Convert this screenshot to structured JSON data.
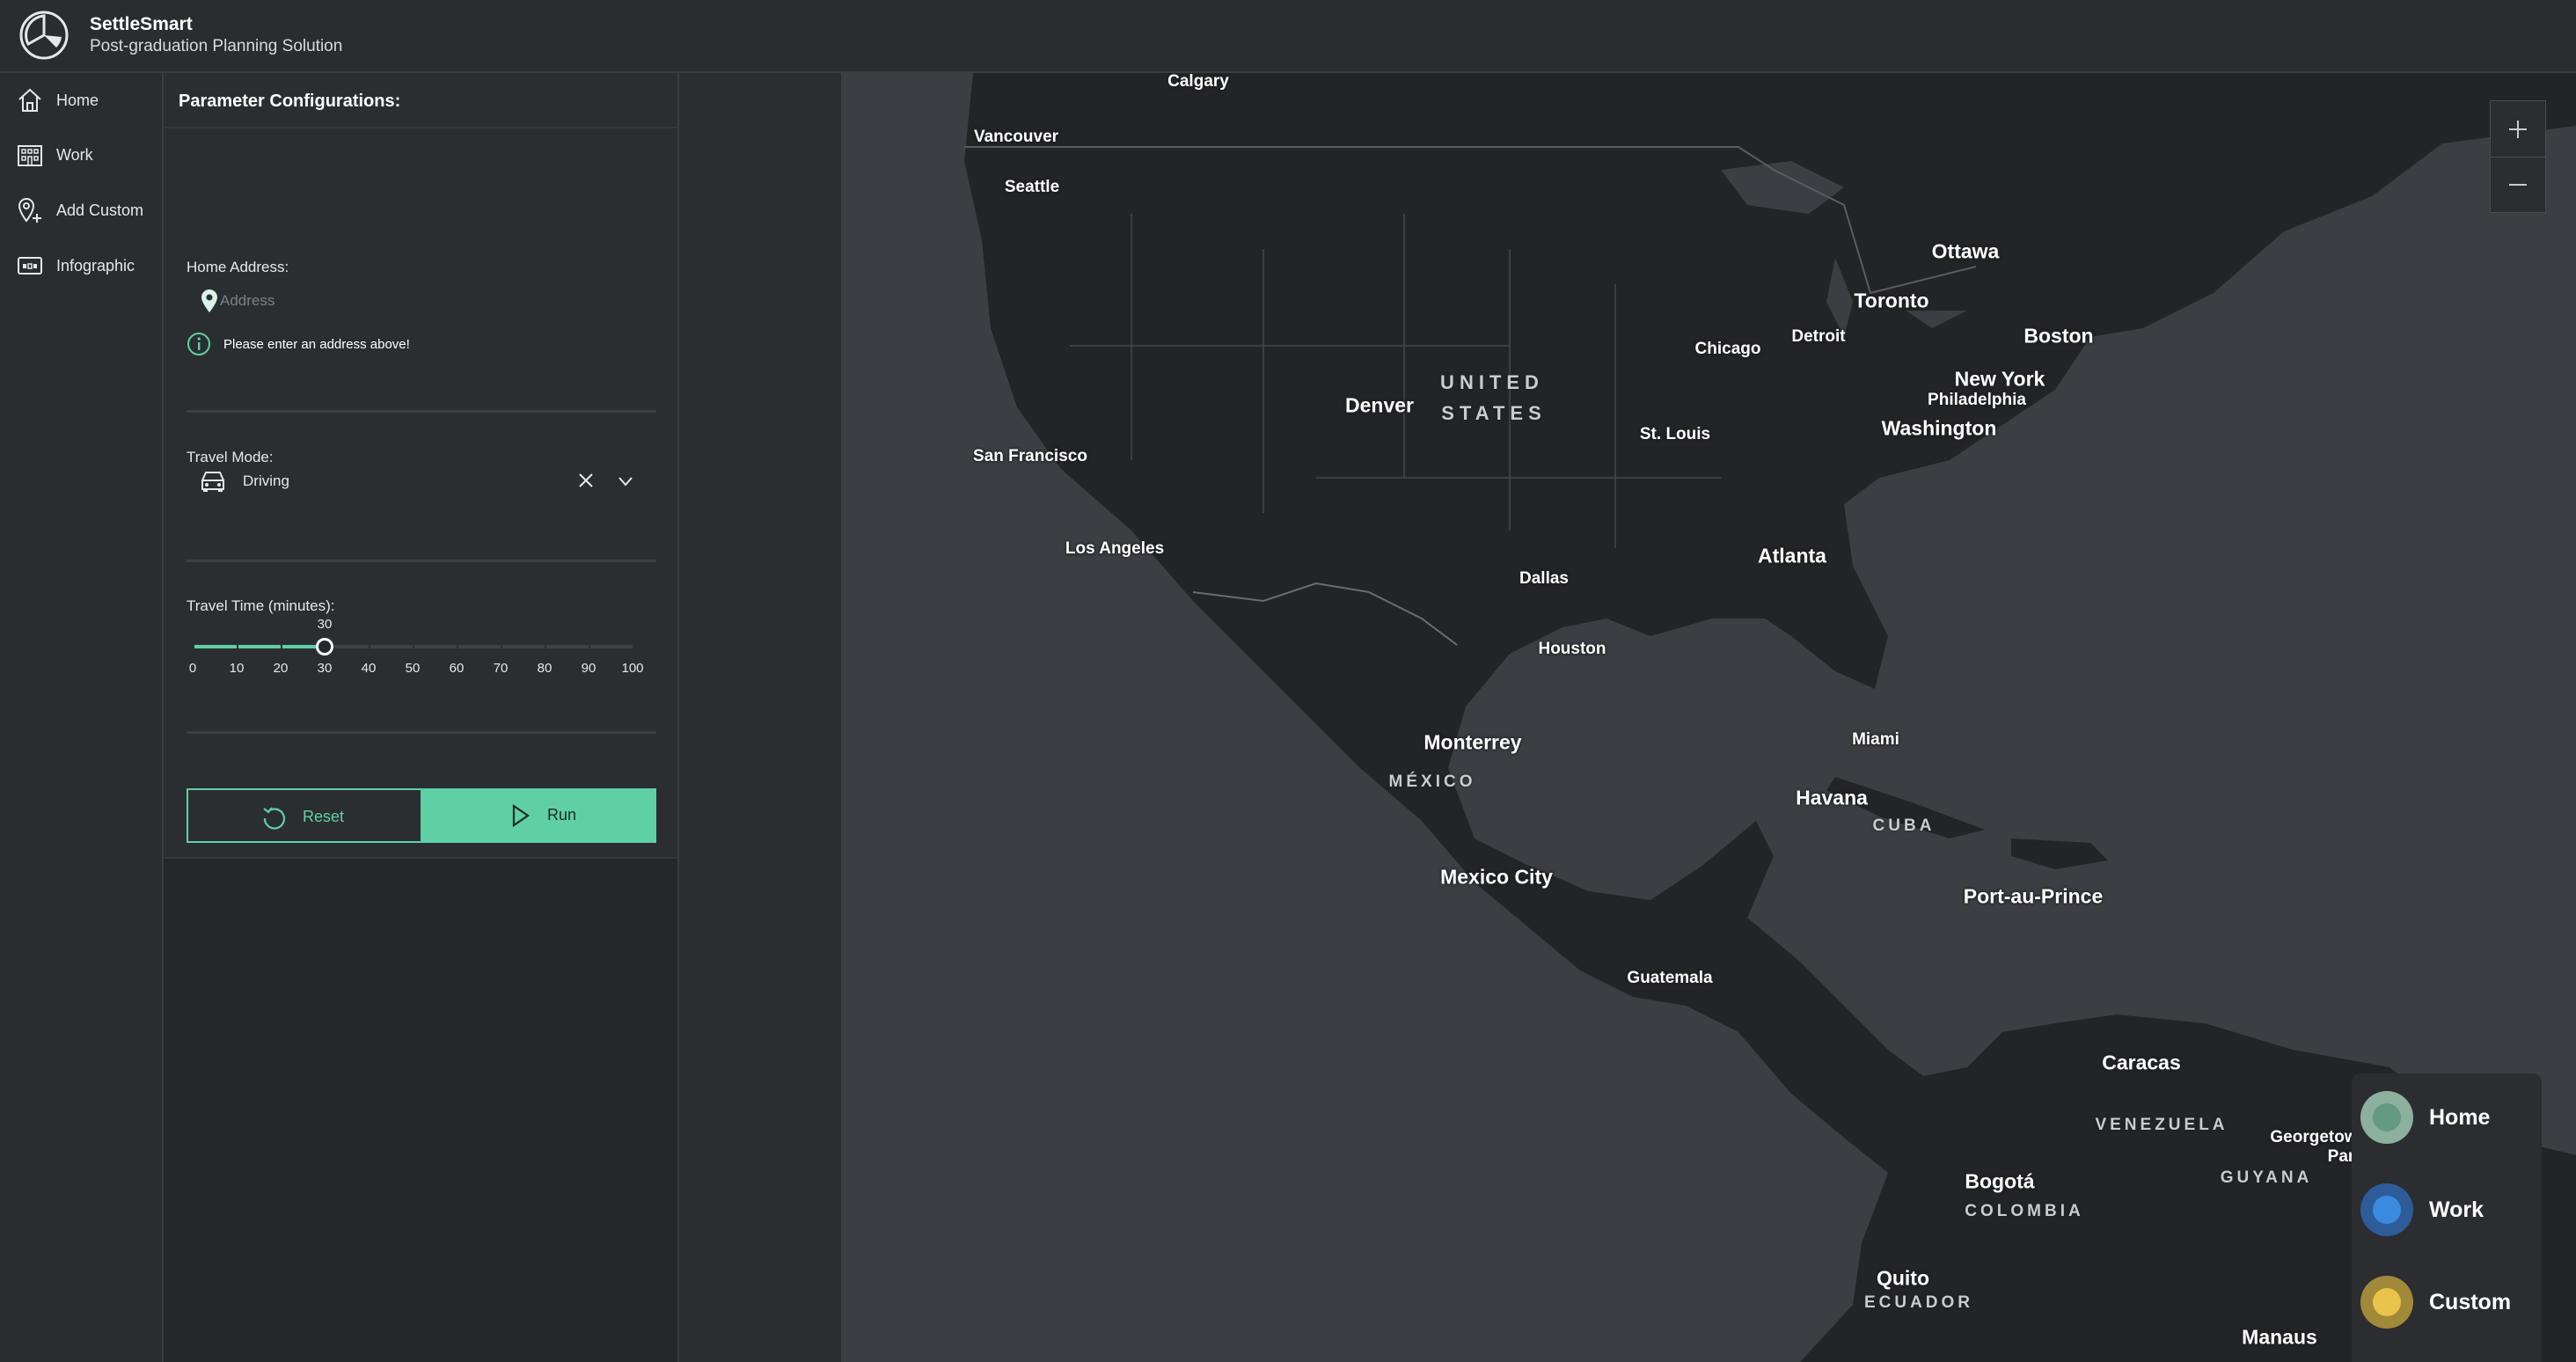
{
  "app": {
    "title": "SettleSmart",
    "subtitle": "Post-graduation Planning Solution"
  },
  "nav": {
    "items": [
      {
        "label": "Home",
        "icon": "home-icon"
      },
      {
        "label": "Work",
        "icon": "building-icon"
      },
      {
        "label": "Add Custom",
        "icon": "add-location-icon"
      },
      {
        "label": "Infographic",
        "icon": "infographic-icon"
      }
    ]
  },
  "panel": {
    "title": "Parameter Configurations:",
    "home_address": {
      "label": "Home Address:",
      "value": "",
      "placeholder": "Address",
      "warning": "Please enter an address above!"
    },
    "travel_mode": {
      "label": "Travel Mode:",
      "value": "Driving"
    },
    "travel_time": {
      "label": "Travel Time (minutes):",
      "value": 30,
      "value_label": "30",
      "min": 0,
      "max": 100,
      "ticks": [
        "0",
        "10",
        "20",
        "30",
        "40",
        "50",
        "60",
        "70",
        "80",
        "90",
        "100"
      ]
    },
    "buttons": {
      "reset": "Reset",
      "run": "Run"
    }
  },
  "map": {
    "cities": [
      {
        "name": "Calgary",
        "size": "s"
      },
      {
        "name": "Vancouver",
        "size": "s"
      },
      {
        "name": "Seattle",
        "size": "s"
      },
      {
        "name": "Ottawa",
        "size": "m"
      },
      {
        "name": "Toronto",
        "size": "m"
      },
      {
        "name": "Detroit",
        "size": "s"
      },
      {
        "name": "Chicago",
        "size": "s"
      },
      {
        "name": "Boston",
        "size": "m"
      },
      {
        "name": "New York",
        "size": "m"
      },
      {
        "name": "Philadelphia",
        "size": "s"
      },
      {
        "name": "Washington",
        "size": "m"
      },
      {
        "name": "Denver",
        "size": "m"
      },
      {
        "name": "St. Louis",
        "size": "s"
      },
      {
        "name": "San Francisco",
        "size": "s"
      },
      {
        "name": "Los Angeles",
        "size": "s"
      },
      {
        "name": "Dallas",
        "size": "s"
      },
      {
        "name": "Atlanta",
        "size": "m"
      },
      {
        "name": "Houston",
        "size": "s"
      },
      {
        "name": "Monterrey",
        "size": "m"
      },
      {
        "name": "Miami",
        "size": "s"
      },
      {
        "name": "Havana",
        "size": "m"
      },
      {
        "name": "Mexico City",
        "size": "m"
      },
      {
        "name": "Port-au-Prince",
        "size": "m"
      },
      {
        "name": "Guatemala",
        "size": "s"
      },
      {
        "name": "Caracas",
        "size": "m"
      },
      {
        "name": "Georgetow",
        "size": "s"
      },
      {
        "name": "Par",
        "size": "s"
      },
      {
        "name": "Bogotá",
        "size": "m"
      },
      {
        "name": "Quito",
        "size": "m"
      },
      {
        "name": "Manaus",
        "size": "m"
      }
    ],
    "countries": [
      {
        "name": "UNITED",
        "big": true
      },
      {
        "name": "STATES",
        "big": true
      },
      {
        "name": "MÉXICO",
        "big": false
      },
      {
        "name": "CUBA",
        "big": false
      },
      {
        "name": "VENEZUELA",
        "big": false
      },
      {
        "name": "GUYANA",
        "big": false
      },
      {
        "name": "COLOMBIA",
        "big": false
      },
      {
        "name": "ECUADOR",
        "big": false
      }
    ],
    "zoom_in": "+",
    "zoom_out": "–"
  },
  "legend": {
    "items": [
      {
        "label": "Home",
        "color": "#6fae8f",
        "ring": "#9ec7b2"
      },
      {
        "label": "Work",
        "color": "#3a8be0",
        "ring": "#2d5c99"
      },
      {
        "label": "Custom",
        "color": "#e8c44a",
        "ring": "#a08a3a"
      }
    ]
  },
  "colors": {
    "accent": "#5fcfa4",
    "background": "#2b2e30",
    "map_water": "#3c3e43",
    "map_land": "#232427"
  }
}
